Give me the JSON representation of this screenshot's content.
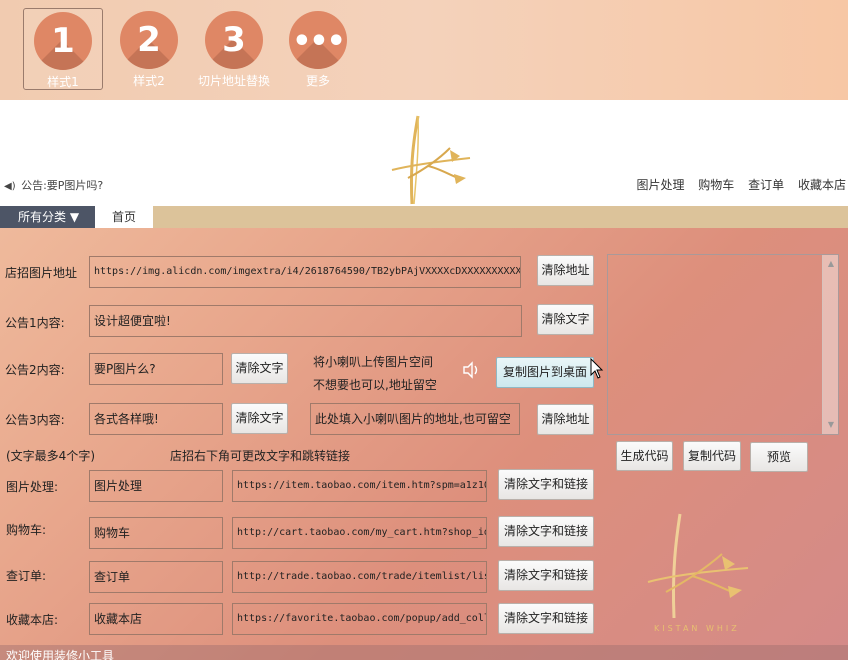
{
  "tabs": [
    {
      "num": "1",
      "label": "样式1"
    },
    {
      "num": "2",
      "label": "样式2"
    },
    {
      "num": "3",
      "label": "切片地址替换"
    },
    {
      "num": "•••",
      "label": "更多"
    }
  ],
  "header": {
    "notice": "公告:要P图片吗?",
    "links": [
      "图片处理",
      "购物车",
      "查订单",
      "收藏本店"
    ]
  },
  "category": {
    "all": "所有分类 ▼",
    "home": "首页"
  },
  "form": {
    "banner_label": "店招图片地址",
    "banner_value": "https://img.alicdn.com/imgextra/i4/2618764590/TB2ybPAjVXXXXcDXXXXXXXXXXXX",
    "clear_address": "清除地址",
    "notice1_label": "公告1内容:",
    "notice1_value": "设计超便宜啦!",
    "clear_text": "清除文字",
    "notice2_label": "公告2内容:",
    "notice2_value": "要P图片么?",
    "speaker_note_1": "将小喇叭上传图片空间",
    "speaker_note_2": "不想要也可以,地址留空",
    "copy_image_btn": "复制图片到桌面",
    "notice3_label": "公告3内容:",
    "notice3_value": "各式各样哦!",
    "speaker_addr_placeholder": "此处填入小喇叭图片的地址,也可留空",
    "max_chars_note": "(文字最多4个字)",
    "link_note": "店招右下角可更改文字和跳转链接",
    "clear_text_link": "清除文字和链接",
    "links": [
      {
        "label": "图片处理:",
        "text": "图片处理",
        "url": "https://item.taobao.com/item.htm?spm=a1z10"
      },
      {
        "label": "购物车:",
        "text": "购物车",
        "url": "http://cart.taobao.com/my_cart.htm?shop_id"
      },
      {
        "label": "查订单:",
        "text": "查订单",
        "url": "http://trade.taobao.com/trade/itemlist/lis"
      },
      {
        "label": "收藏本店:",
        "text": "收藏本店",
        "url": "https://favorite.taobao.com/popup/add_coll"
      }
    ]
  },
  "actions": {
    "generate": "生成代码",
    "copy": "复制代码",
    "preview": "预览"
  },
  "watermark": "KISTAN WHIZ",
  "footer": "欢迎使用装修小工具",
  "colors": {
    "accent": "#df8765",
    "gold": "#e0b45a",
    "catbar": "#dcc39a",
    "cat_dark": "#4d5566"
  }
}
